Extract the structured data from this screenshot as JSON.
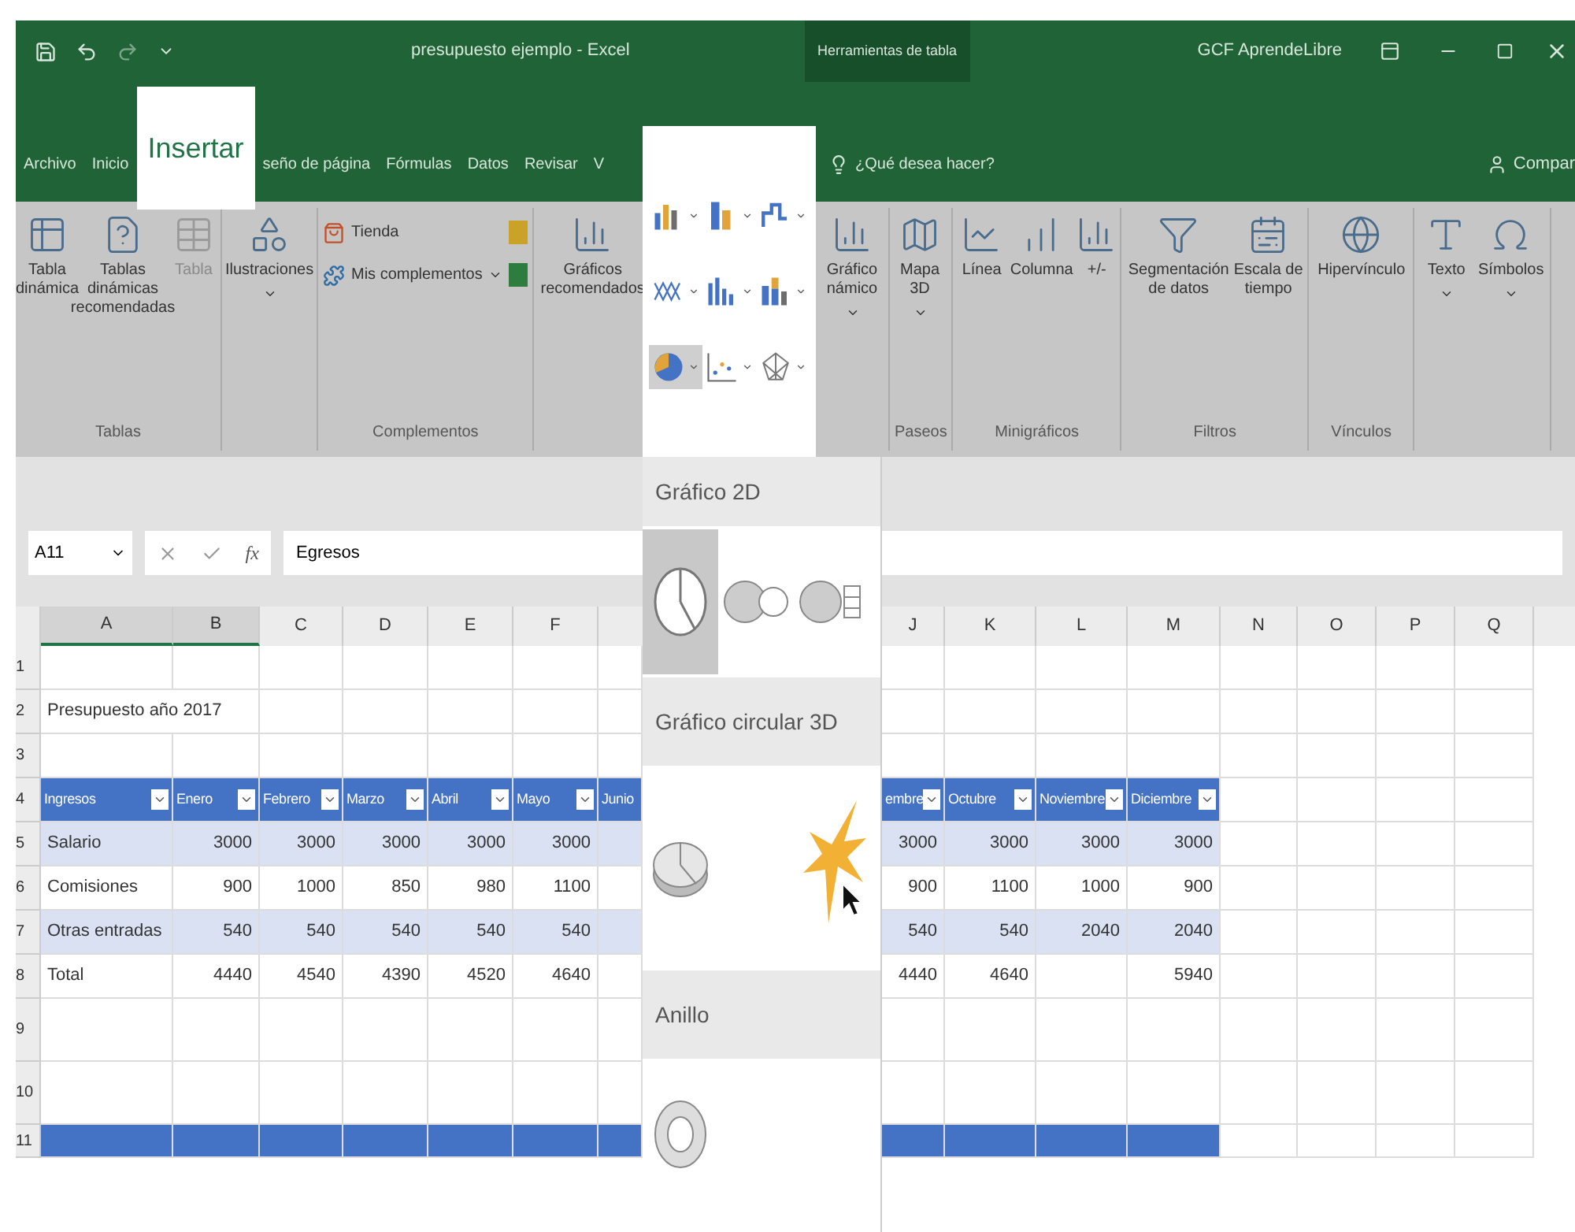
{
  "title_bar": {
    "title": "presupuesto ejemplo - Excel",
    "context_title": "Herramientas de tabla",
    "user": "GCF AprendeLibre"
  },
  "tabs": [
    {
      "label": "Archivo",
      "selected": false
    },
    {
      "label": "Inicio",
      "selected": false
    },
    {
      "label": "Insertar",
      "selected": true
    },
    {
      "label": "seño de página",
      "selected": false
    },
    {
      "label": "Fórmulas",
      "selected": false
    },
    {
      "label": "Datos",
      "selected": false
    },
    {
      "label": "Revisar",
      "selected": false
    },
    {
      "label": "V",
      "selected": false
    }
  ],
  "tell_me": {
    "placeholder": "¿Qué desea hacer?"
  },
  "share": "Compar",
  "ribbon_left": [
    {
      "label": "Tablas",
      "buttons": [
        {
          "label": "Tabla dinámica",
          "disabled": false,
          "dropdown": false
        },
        {
          "label": "Tablas dinámicas recomendadas",
          "disabled": false,
          "dropdown": false
        },
        {
          "label": "Tabla",
          "disabled": true,
          "dropdown": false
        }
      ]
    },
    {
      "buttons": [
        {
          "label": "Ilustraciones",
          "disabled": false,
          "dropdown": true
        }
      ]
    },
    {
      "label": "Complementos",
      "small_buttons": [
        {
          "label": "Tienda",
          "dropdown": false
        },
        {
          "label": "Mis complementos",
          "dropdown": true
        }
      ]
    },
    {
      "buttons": [
        {
          "label": "Gráficos recomendados",
          "disabled": false,
          "dropdown": false
        }
      ]
    }
  ],
  "ribbon_right": [
    {
      "buttons": [
        {
          "label": "Gráfico námico",
          "disabled": false,
          "dropdown": true
        }
      ]
    },
    {
      "label": "Paseos",
      "buttons": [
        {
          "label": "Mapa 3D",
          "disabled": false,
          "dropdown": true
        }
      ]
    },
    {
      "label": "Minigráficos",
      "buttons": [
        {
          "label": "Línea",
          "disabled": false,
          "dropdown": false
        },
        {
          "label": "Columna",
          "disabled": false,
          "dropdown": false
        },
        {
          "label": "+/-",
          "disabled": false,
          "dropdown": false
        }
      ]
    },
    {
      "label": "Filtros",
      "buttons": [
        {
          "label": "Segmentación de datos",
          "disabled": false,
          "dropdown": false
        },
        {
          "label": "Escala de tiempo",
          "disabled": false,
          "dropdown": false
        }
      ]
    },
    {
      "label": "Vínculos",
      "buttons": [
        {
          "label": "Hipervínculo",
          "disabled": false,
          "dropdown": false
        }
      ]
    },
    {
      "buttons": [
        {
          "label": "Texto",
          "disabled": false,
          "dropdown": true
        },
        {
          "label": "Símbolos",
          "disabled": false,
          "dropdown": true
        }
      ]
    }
  ],
  "chart_menu": {
    "chart_buttons": [
      {
        "selected": false
      },
      {
        "selected": false
      },
      {
        "selected": false
      },
      {
        "selected": false
      },
      {
        "selected": false
      },
      {
        "selected": false
      },
      {
        "selected": true
      },
      {
        "selected": false
      },
      {
        "selected": false
      }
    ],
    "sections": [
      {
        "title": "Gráfico 2D",
        "options": [
          {
            "selected": true
          },
          {
            "selected": false
          },
          {
            "selected": false
          }
        ]
      },
      {
        "title": "Gráfico circular 3D",
        "options": [
          {
            "selected": false
          }
        ]
      },
      {
        "title": "Anillo",
        "options": [
          {
            "selected": false
          }
        ]
      }
    ]
  },
  "formula_bar": {
    "name_box": "A11",
    "function_symbol": "fx",
    "value": "Egresos"
  },
  "columns": [
    {
      "label": "A",
      "selected": true
    },
    {
      "label": "B",
      "selected": true
    },
    {
      "label": "C",
      "selected": false
    },
    {
      "label": "D",
      "selected": false
    },
    {
      "label": "E",
      "selected": false
    },
    {
      "label": "F",
      "selected": false
    },
    {
      "label": "J",
      "selected": false
    },
    {
      "label": "K",
      "selected": false
    },
    {
      "label": "L",
      "selected": false
    },
    {
      "label": "M",
      "selected": false
    },
    {
      "label": "N",
      "selected": false
    },
    {
      "label": "O",
      "selected": false
    },
    {
      "label": "P",
      "selected": false
    },
    {
      "label": "Q",
      "selected": false
    }
  ],
  "rows": [
    {
      "number": "1",
      "kind": "empty"
    },
    {
      "number": "2",
      "kind": "title",
      "cells": [
        "Presupuesto año 2017"
      ]
    },
    {
      "number": "3",
      "kind": "empty"
    },
    {
      "number": "4",
      "kind": "table_header",
      "cells": [
        "Ingresos",
        "Enero",
        "Febrero",
        "Marzo",
        "Abril",
        "Mayo",
        "embre",
        "Octubre",
        "Noviembre",
        "Diciembre"
      ],
      "partial_cell": "Junio"
    },
    {
      "number": "5",
      "kind": "band",
      "cells": [
        "Salario",
        "3000",
        "3000",
        "3000",
        "3000",
        "3000",
        "3000",
        "3000",
        "3000",
        "3000"
      ]
    },
    {
      "number": "6",
      "kind": "plain",
      "cells": [
        "Comisiones",
        "900",
        "1000",
        "850",
        "980",
        "1100",
        "900",
        "1100",
        "1000",
        "900"
      ]
    },
    {
      "number": "7",
      "kind": "band",
      "cells": [
        "Otras entradas",
        "540",
        "540",
        "540",
        "540",
        "540",
        "540",
        "540",
        "2040",
        "2040"
      ]
    },
    {
      "number": "8",
      "kind": "plain",
      "cells": [
        "Total",
        "4440",
        "4540",
        "4390",
        "4520",
        "4640",
        "4440",
        "4640",
        null,
        "5940"
      ]
    },
    {
      "number": "9",
      "kind": "empty"
    },
    {
      "number": "10",
      "kind": "empty"
    },
    {
      "number": "11",
      "kind": "blurred_header"
    }
  ]
}
